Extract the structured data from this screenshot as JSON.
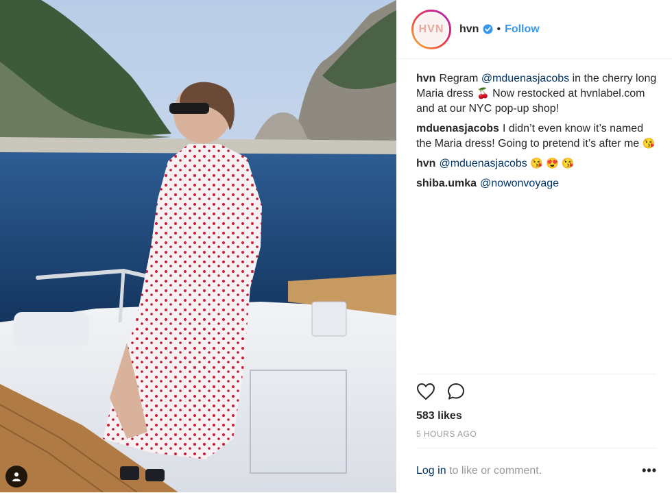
{
  "post": {
    "username": "hvn",
    "avatar_text": "HVN",
    "separator": "•",
    "follow_label": "Follow",
    "comments": [
      {
        "user": "hvn",
        "parts": [
          {
            "t": "Regram "
          },
          {
            "t": "@mduenasjacobs",
            "m": true
          },
          {
            "t": " in the cherry long Maria dress "
          },
          {
            "t": "🍒",
            "e": true
          },
          {
            "t": " Now restocked at hvnlabel.com and at our NYC pop-up shop!"
          }
        ]
      },
      {
        "user": "mduenasjacobs",
        "parts": [
          {
            "t": "I didn’t even know it’s named the Maria dress! Going to pretend it’s after me "
          },
          {
            "t": "😘",
            "e": true
          }
        ]
      },
      {
        "user": "hvn",
        "parts": [
          {
            "t": "@mduenasjacobs",
            "m": true
          },
          {
            "t": " "
          },
          {
            "t": "😘 😍 😘",
            "e": true
          }
        ]
      },
      {
        "user": "shiba.umka",
        "parts": [
          {
            "t": "@nowonvoyage",
            "m": true
          }
        ]
      }
    ],
    "likes": "583 likes",
    "timestamp": "5 HOURS AGO",
    "login_link": "Log in",
    "login_rest": " to like or comment.",
    "more_label": "•••"
  },
  "icons": {
    "like": "heart-icon",
    "comment": "comment-icon",
    "verified": "verified-badge-icon",
    "tagged": "person-tag-icon"
  },
  "colors": {
    "link_blue": "#3897f0",
    "mention_blue": "#003569",
    "muted": "#999999"
  }
}
